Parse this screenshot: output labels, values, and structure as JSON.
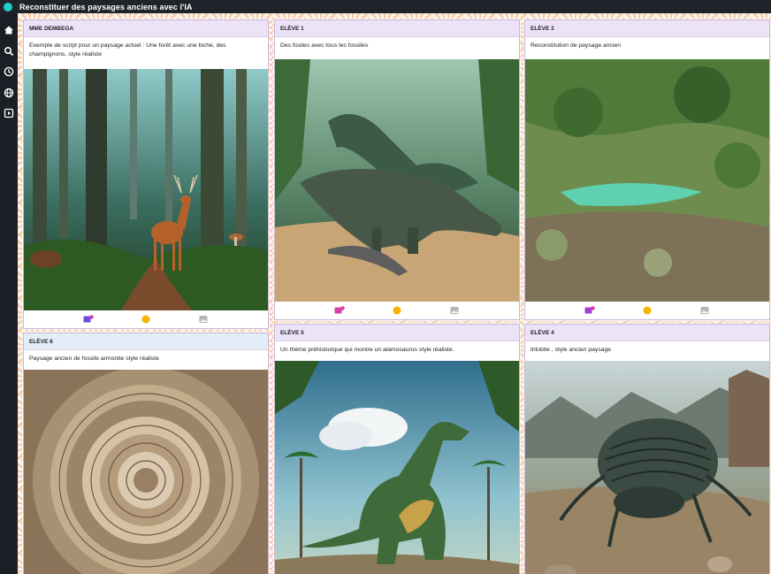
{
  "app": {
    "title": "Reconstituer des paysages anciens avec l'IA"
  },
  "sidebar": {
    "icons": [
      "home-icon",
      "search-icon",
      "clock-icon",
      "globe-icon",
      "play-icon"
    ]
  },
  "cards": [
    {
      "author": "MME DEMBEGA",
      "text": "Exemple de script pour un paysage actuel : Une forêt avec une biche, des champignons, style réaliste"
    },
    {
      "author": "ELÈVE 1",
      "text": "Des fosiles avec tous les fossiles"
    },
    {
      "author": "ELÈVE 2",
      "text": "Reconstitution de paysage ancien"
    },
    {
      "author": "ELÈVE 6",
      "text": "Paysage ancien de fossile armonite style réaliste"
    },
    {
      "author": "ELÈVE 5",
      "text": "Un thème préhistorique qui montre un alamosaurus style réaliste."
    },
    {
      "author": "ELÈVE 4",
      "text": "trilobite , style ancien paysage"
    }
  ],
  "footer_icons": [
    "comment-badge-icon",
    "reaction-icon",
    "image-icon"
  ],
  "colors": {
    "header_purple": "#ece3f9",
    "header_blue": "#e2edf8",
    "accent_teal": "#1fd1c8",
    "reaction": "#f5b400",
    "comment": "#d63fa6"
  }
}
